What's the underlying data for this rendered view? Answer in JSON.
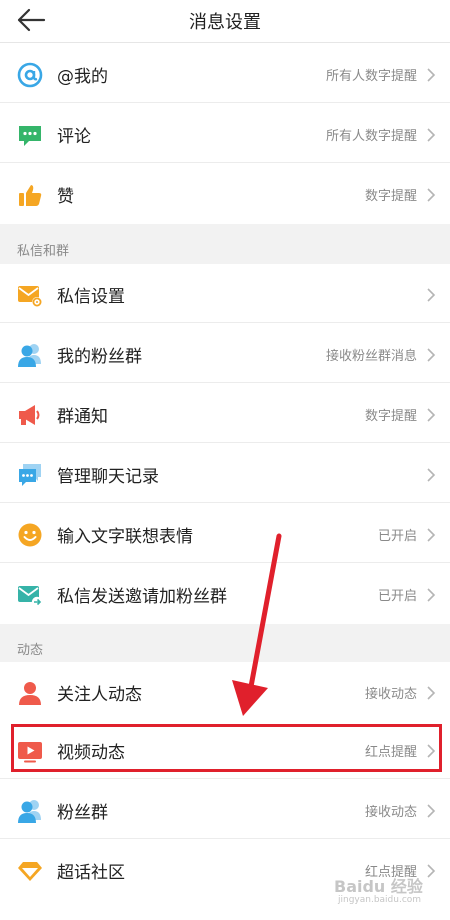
{
  "header": {
    "title": "消息设置"
  },
  "top_items": [
    {
      "label": "@我的",
      "value": "所有人数字提醒"
    },
    {
      "label": "评论",
      "value": "所有人数字提醒"
    },
    {
      "label": "赞",
      "value": "数字提醒"
    }
  ],
  "sections": [
    {
      "title": "私信和群",
      "items": [
        {
          "label": "私信设置",
          "value": ""
        },
        {
          "label": "我的粉丝群",
          "value": "接收粉丝群消息"
        },
        {
          "label": "群通知",
          "value": "数字提醒"
        },
        {
          "label": "管理聊天记录",
          "value": ""
        },
        {
          "label": "输入文字联想表情",
          "value": "已开启"
        },
        {
          "label": "私信发送邀请加粉丝群",
          "value": "已开启"
        }
      ]
    },
    {
      "title": "动态",
      "items": [
        {
          "label": "关注人动态",
          "value": "接收动态"
        },
        {
          "label": "视频动态",
          "value": "红点提醒"
        },
        {
          "label": "粉丝群",
          "value": "接收动态"
        },
        {
          "label": "超话社区",
          "value": "红点提醒"
        }
      ]
    }
  ],
  "watermark": {
    "brand": "Baidu 经验",
    "url": "jingyan.baidu.com"
  },
  "colors": {
    "blue": "#39a7e6",
    "green": "#35b56a",
    "orange": "#f5a623",
    "red": "#ef5a4b",
    "highlight_red": "#e0202c"
  },
  "icons": [
    "at-icon",
    "comment-icon",
    "thumbs-up-icon",
    "mail-settings-icon",
    "fan-group-icon",
    "megaphone-icon",
    "chat-history-icon",
    "emoji-icon",
    "mail-invite-icon",
    "person-icon",
    "video-icon",
    "fan-group-icon",
    "diamond-icon"
  ]
}
